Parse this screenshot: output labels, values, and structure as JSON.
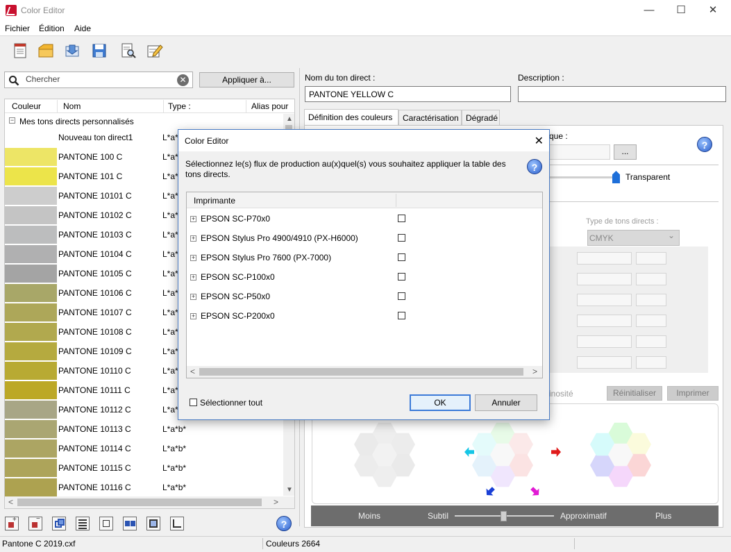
{
  "window": {
    "title": "Color Editor",
    "minimize": "—",
    "maximize": "☐",
    "close": "✕"
  },
  "menu": {
    "items": [
      "Fichier",
      "Édition",
      "Aide"
    ]
  },
  "search": {
    "placeholder": "Chercher",
    "clear": "✕"
  },
  "apply_button": "Appliquer à...",
  "list": {
    "columns": [
      "Couleur",
      "Nom",
      "Type :",
      "Alias pour"
    ],
    "group_label": "Mes tons directs personnalisés",
    "group_toggle": "−",
    "rows": [
      {
        "name": "Nouveau ton direct1",
        "type": "L*a*",
        "color": "#ffffff"
      },
      {
        "name": "PANTONE 100 C",
        "type": "L*a*",
        "color": "#ede566"
      },
      {
        "name": "PANTONE 101 C",
        "type": "L*a*",
        "color": "#ece44a"
      },
      {
        "name": "PANTONE 10101 C",
        "type": "L*a*",
        "color": "#cdcdcd"
      },
      {
        "name": "PANTONE 10102 C",
        "type": "L*a*",
        "color": "#c4c4c4"
      },
      {
        "name": "PANTONE 10103 C",
        "type": "L*a*",
        "color": "#bcbdbe"
      },
      {
        "name": "PANTONE 10104 C",
        "type": "L*a*",
        "color": "#b0b0b1"
      },
      {
        "name": "PANTONE 10105 C",
        "type": "L*a*",
        "color": "#a4a4a4"
      },
      {
        "name": "PANTONE 10106 C",
        "type": "L*a*",
        "color": "#a8a768"
      },
      {
        "name": "PANTONE 10107 C",
        "type": "L*a*",
        "color": "#ada759"
      },
      {
        "name": "PANTONE 10108 C",
        "type": "L*a*",
        "color": "#b1a94e"
      },
      {
        "name": "PANTONE 10109 C",
        "type": "L*a*",
        "color": "#b5aa3f"
      },
      {
        "name": "PANTONE 10110 C",
        "type": "L*a*",
        "color": "#b8aa33"
      },
      {
        "name": "PANTONE 10111 C",
        "type": "L*a*",
        "color": "#bca826"
      },
      {
        "name": "PANTONE 10112 C",
        "type": "L*a*",
        "color": "#a8a686"
      },
      {
        "name": "PANTONE 10113 C",
        "type": "L*a*b*",
        "color": "#aaa672"
      },
      {
        "name": "PANTONE 10114 C",
        "type": "L*a*b*",
        "color": "#aca563"
      },
      {
        "name": "PANTONE 10115 C",
        "type": "L*a*b*",
        "color": "#ada45a"
      },
      {
        "name": "PANTONE 10116 C",
        "type": "L*a*b*",
        "color": "#ada250"
      }
    ]
  },
  "status": {
    "file": "Pantone C 2019.cxf",
    "count": "Couleurs 2664"
  },
  "right": {
    "name_label": "Nom du ton direct :",
    "name_value": "PANTONE YELLOW C",
    "desc_label": "Description :",
    "desc_value": "",
    "tabs": [
      "Définition des couleurs",
      "Caractérisation",
      "Dégradé"
    ],
    "partial_label": "que :",
    "browse": "...",
    "transparent": "Transparent",
    "type_label": "Type de tons directs :",
    "type_value": "CMYK",
    "luminosity_partial": "inosité",
    "reset": "Réinitialiser",
    "print": "Imprimer",
    "bottom": [
      "Moins",
      "Subtil",
      "Approximatif",
      "Plus"
    ]
  },
  "dialog": {
    "title": "Color Editor",
    "close": "✕",
    "message": "Sélectionnez le(s) flux de production au(x)quel(s) vous souhaitez appliquer la table des tons directs.",
    "help": "?",
    "column": "Imprimante",
    "printers": [
      "EPSON SC-P70x0",
      "EPSON Stylus Pro 4900/4910 (PX-H6000)",
      "EPSON Stylus Pro 7600 (PX-7000)",
      "EPSON SC-P100x0",
      "EPSON SC-P50x0",
      "EPSON SC-P200x0"
    ],
    "expand": "+",
    "select_all": "Sélectionner tout",
    "ok": "OK",
    "cancel": "Annuler"
  },
  "icons": {
    "help": "?",
    "scroll_up": "▲",
    "scroll_down": "▼",
    "scroll_left": "<",
    "scroll_right": ">",
    "dropdown": "⌄"
  }
}
